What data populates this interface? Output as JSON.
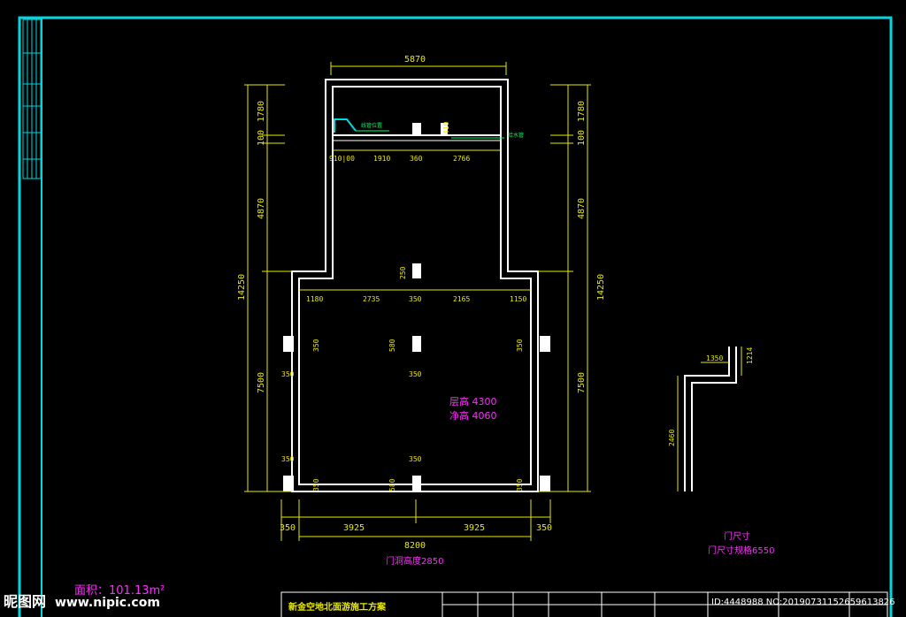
{
  "colors": {
    "frame": "#00d8e0",
    "wall": "#ffffff",
    "dimension": "#e8e800",
    "note": "#ff2cff",
    "line": "#00ff66"
  },
  "dimensions": {
    "top_width": "5870",
    "left_top_a": "1780",
    "left_top_b": "100",
    "left_upper": "4870",
    "left_total": "14250",
    "left_lower": "7500",
    "right_top_a": "1780",
    "right_top_b": "100",
    "right_upper": "4870",
    "right_total": "14250",
    "right_lower": "7500",
    "upper_row": [
      "910|00",
      "1910",
      "360",
      "2766"
    ],
    "upper_height_mark": "410",
    "mid_row": [
      "1180",
      "2735",
      "350",
      "2165",
      "1150"
    ],
    "col_mark": "250",
    "col_marks_350": [
      "350",
      "350",
      "350",
      "350",
      "350",
      "350",
      "350",
      "350"
    ],
    "col_marks_580": [
      "580",
      "580"
    ],
    "bottom_row": [
      "350",
      "3925",
      "3925",
      "350"
    ],
    "bottom_total": "8200",
    "detail_a": "1350",
    "detail_b": "1214",
    "detail_c": "2460"
  },
  "notes": {
    "height_a": "层高 4300",
    "height_b": "净高 4060",
    "door_note": "门洞高度2850",
    "area": "面积：101.13m²",
    "detail_title": "门尺寸",
    "detail_sub": "门尺寸规格6550",
    "leader_a": "线管位置",
    "leader_b": "给水管"
  },
  "title_block": {
    "project": "新金空地北面游施工方案"
  },
  "watermark": {
    "logo": "昵图网",
    "url": "www.nipic.com",
    "id": "ID:4448988 NO:20190731152659613826"
  }
}
